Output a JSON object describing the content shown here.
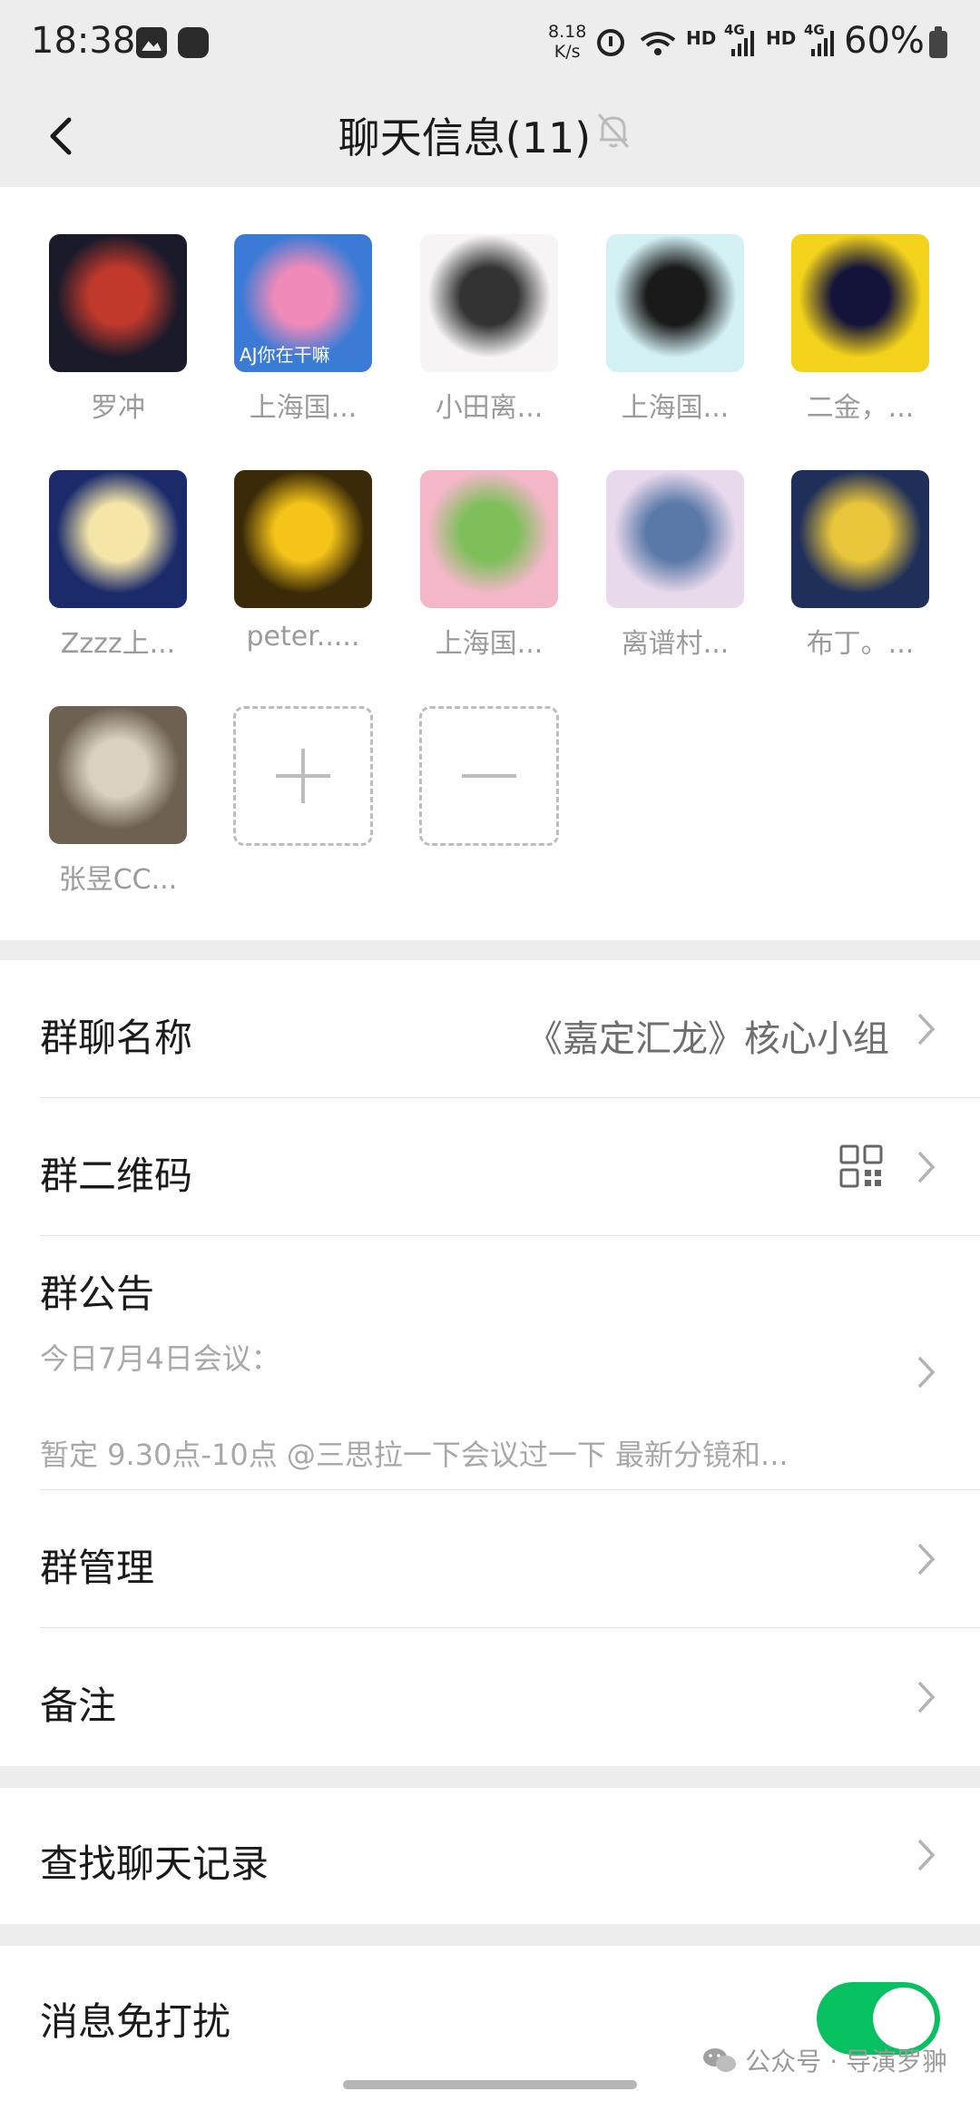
{
  "status_bar": {
    "time": "18:38",
    "net_speed_value": "8.18",
    "net_speed_unit": "K/s",
    "hd1": "HD",
    "sig1": "4G",
    "hd2": "HD",
    "sig2": "4G",
    "battery": "60%"
  },
  "nav": {
    "title": "聊天信息(11)",
    "back_icon": "chevron-left-icon",
    "mute_icon": "bell-off-icon"
  },
  "members": [
    {
      "name": "罗冲",
      "colors": [
        "#1a1a2a",
        "#c0392b"
      ]
    },
    {
      "name": "上海国...",
      "colors": [
        "#3b7bd6",
        "#f08ab8"
      ],
      "avatar_text": "AJ你在干嘛"
    },
    {
      "name": "小田离...",
      "colors": [
        "#f6f4f4",
        "#333333"
      ]
    },
    {
      "name": "上海国...",
      "colors": [
        "#d3f1f5",
        "#1a1a1a"
      ]
    },
    {
      "name": "二金，...",
      "colors": [
        "#f2d21a",
        "#14143a"
      ]
    },
    {
      "name": "Zzzz上...",
      "colors": [
        "#1a2a6a",
        "#f5e6a8"
      ]
    },
    {
      "name": "peter.....",
      "colors": [
        "#3a2a08",
        "#f5c418"
      ]
    },
    {
      "name": "上海国...",
      "colors": [
        "#f3b7c8",
        "#7fbf5a"
      ]
    },
    {
      "name": "离谱村...",
      "colors": [
        "#e9d9ec",
        "#5a79a8"
      ]
    },
    {
      "name": "布丁。...",
      "colors": [
        "#1f2f5a",
        "#e8c53a"
      ]
    },
    {
      "name": "张昱CC...",
      "colors": [
        "#6e6152",
        "#d8d2c2"
      ]
    }
  ],
  "settings": {
    "group_name_label": "群聊名称",
    "group_name_value": "《嘉定汇龙》核心小组",
    "qr_label": "群二维码",
    "notice_label": "群公告",
    "notice_line1": "今日7月4日会议：",
    "notice_line2": "暂定 9.30点-10点 @三思拉一下会议过一下 最新分镜和...",
    "manage_label": "群管理",
    "remark_label": "备注",
    "search_label": "查找聊天记录",
    "dnd_label": "消息免打扰",
    "dnd_on": true
  },
  "watermark": {
    "text": "公众号 · 导演罗翀"
  },
  "colors": {
    "accent_green": "#07c160",
    "background": "#ededed"
  }
}
